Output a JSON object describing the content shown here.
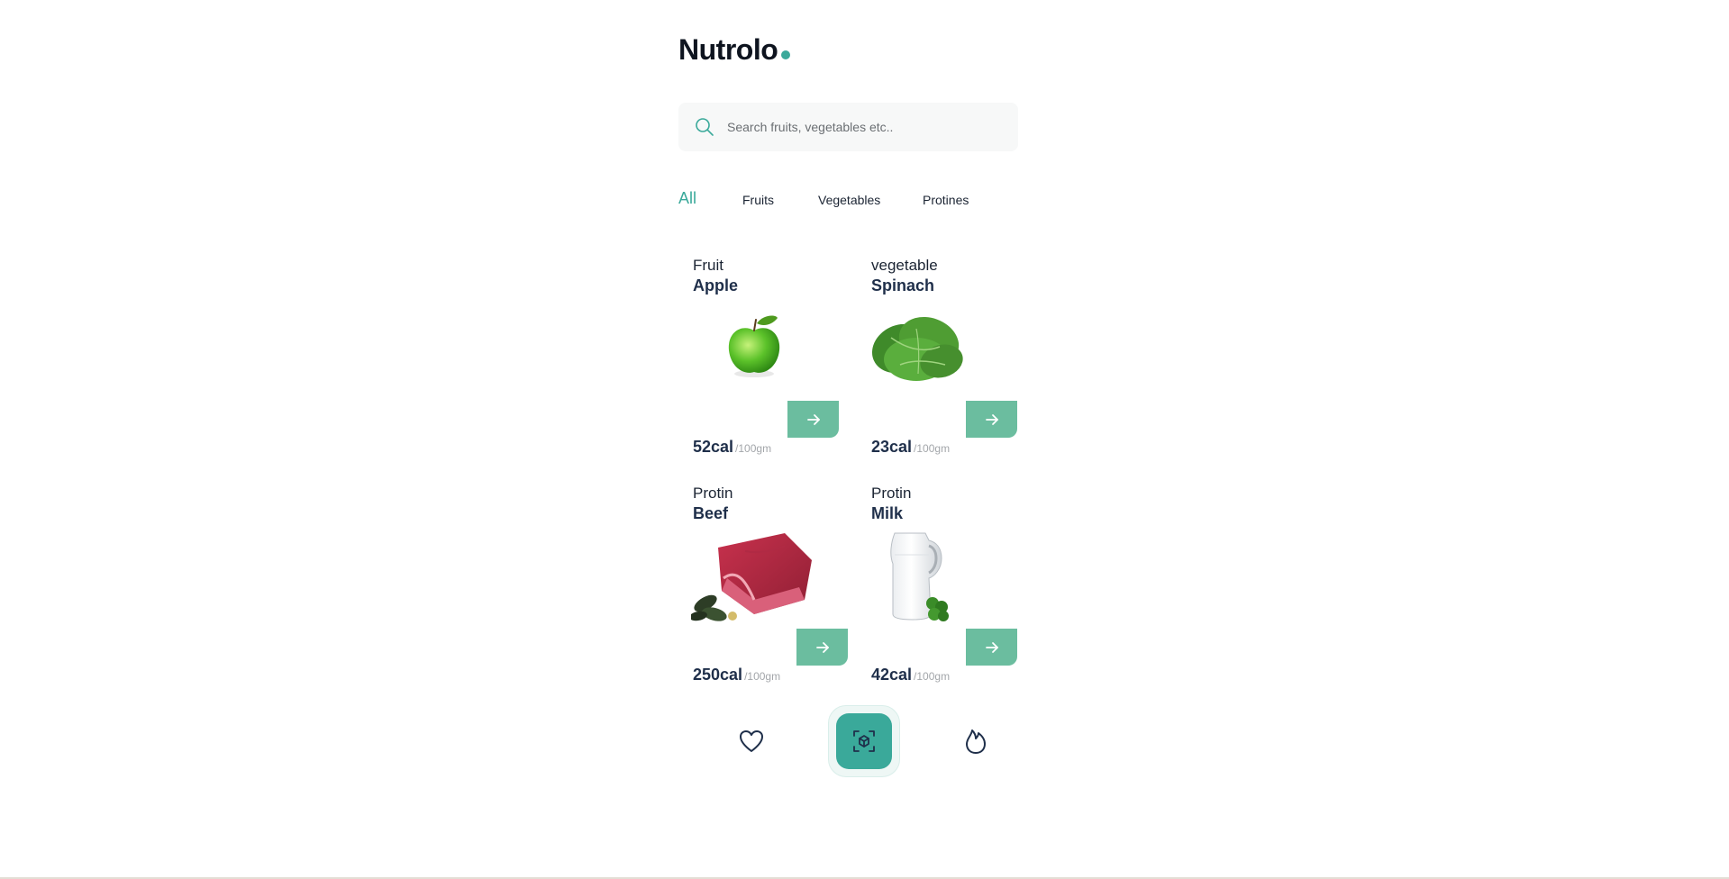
{
  "app": {
    "logo_text": "Nutrolo"
  },
  "search": {
    "placeholder": "Search fruits, vegetables etc.."
  },
  "tabs": [
    {
      "label": "All",
      "active": true
    },
    {
      "label": "Fruits",
      "active": false
    },
    {
      "label": "Vegetables",
      "active": false
    },
    {
      "label": "Protines",
      "active": false
    }
  ],
  "foods": [
    {
      "type": "Fruit",
      "name": "Apple",
      "cal": "52cal",
      "unit": "/100gm",
      "icon": "apple-image"
    },
    {
      "type": "vegetable",
      "name": "Spinach",
      "cal": "23cal",
      "unit": "/100gm",
      "icon": "spinach-image"
    },
    {
      "type": "Protin",
      "name": "Beef",
      "cal": "250cal",
      "unit": "/100gm",
      "icon": "beef-image"
    },
    {
      "type": "Protin",
      "name": "Milk",
      "cal": "42cal",
      "unit": "/100gm",
      "icon": "milk-image"
    }
  ],
  "bottom_nav": {
    "left_icon": "heart-icon",
    "center_icon": "scan-icon",
    "right_icon": "flame-icon"
  },
  "colors": {
    "accent": "#3aa99a",
    "button": "#6bbd9f",
    "text_dark": "#1f2f4a"
  }
}
